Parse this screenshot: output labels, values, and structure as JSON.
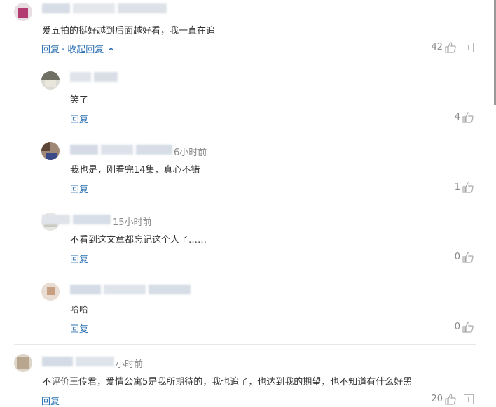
{
  "comments": [
    {
      "text": "爱五拍的挺好越到后面越好看，我一直在追",
      "reply_label": "回复",
      "collapse_label": "· 收起回复",
      "like_count": "42"
    },
    {
      "text": "笑了",
      "reply_label": "回复",
      "like_count": "4"
    },
    {
      "time": "6小时前",
      "text": "我也是，刚看完14集，真心不错",
      "reply_label": "回复",
      "like_count": "1"
    },
    {
      "time": "15小时前",
      "text": "不看到这文章都忘记这个人了……",
      "reply_label": "回复",
      "like_count": "0"
    },
    {
      "text": "哈哈",
      "reply_label": "回复",
      "like_count": "0"
    },
    {
      "time": "小时前",
      "text": "不评价王传君，爱情公寓5是我所期待的，我也追了，也达到我的期望，也不知道有什么好黑",
      "reply_label": "回复",
      "like_count": "20"
    }
  ],
  "colors": {
    "link": "#2a6fb0",
    "muted": "#888888",
    "text": "#333333"
  },
  "icons": [
    "thumbs-up-icon",
    "report-icon",
    "chevron-up-icon"
  ]
}
